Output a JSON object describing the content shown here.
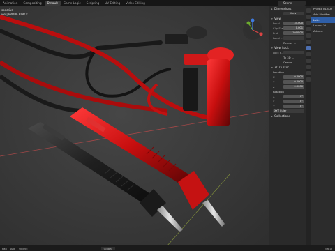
{
  "topbar": {
    "tabs": [
      "Animation",
      "Compositing",
      "Default",
      "Game Logic",
      "Scripting",
      "UV Editing",
      "Video Editing"
    ],
    "active_tab": "Default",
    "scene": "Scene"
  },
  "viewport": {
    "mode_label": "spective",
    "object_label": "ion | PROBE BLACK"
  },
  "npanel": {
    "dimensions_header": "Dimensions",
    "view_header": "View",
    "view_button": "View",
    "focal_label": "Focal ...",
    "focal_value": "35.000",
    "clip_start_label": "Clip Start",
    "clip_start_value": "0.001",
    "end_label": "End",
    "end_value": "1000.00",
    "local_label": "Local ...",
    "render_label": "Render ...",
    "view_lock_header": "View Lock",
    "lock_label": "Lock t...",
    "lock_to_3d": "To 3D ...",
    "lock_camera": "Camer...",
    "cursor_header": "3D Cursor",
    "location_label": "Location",
    "rotation_label": "Rotation",
    "axes": [
      "X",
      "Y",
      "Z"
    ],
    "location_values": [
      "0.0000",
      "0.0000",
      "0.0000"
    ],
    "rotation_values": [
      "0°",
      "0°",
      "0°"
    ],
    "rotation_mode": "XYZ Euler",
    "collections_header": "Collections"
  },
  "properties": {
    "object_name": "PROBE BLACK",
    "add_modifier": "Add Modifier",
    "modifier_name": "Lat...",
    "field_a": "Lineart Vi",
    "field_b": "Advanc"
  },
  "bottombar": {
    "items": [
      "Pan",
      "Add",
      "Object"
    ],
    "global": "Global",
    "version": "3.6.0"
  }
}
